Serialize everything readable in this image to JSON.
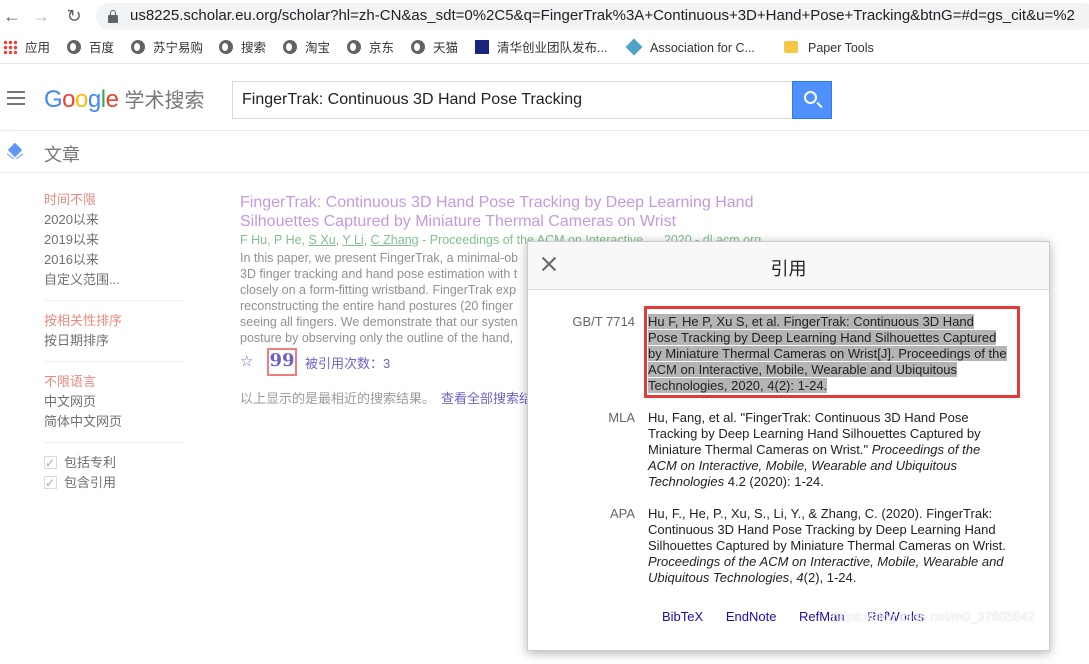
{
  "browser": {
    "url": "us8225.scholar.eu.org/scholar?hl=zh-CN&as_sdt=0%2C5&q=FingerTrak%3A+Continuous+3D+Hand+Pose+Tracking&btnG=#d=gs_cit&u=%2",
    "bookmarks": [
      "应用",
      "百度",
      "苏宁易购",
      "搜索",
      "淘宝",
      "京东",
      "天猫",
      "清华创业团队发布...",
      "Association for C...",
      "Paper Tools"
    ]
  },
  "header": {
    "logo_letters": [
      "G",
      "o",
      "o",
      "g",
      "l",
      "e"
    ],
    "logo_suffix": "学术搜索",
    "search_value": "FingerTrak: Continuous 3D Hand Pose Tracking",
    "section_title": "文章"
  },
  "sidebar": {
    "time_filters": [
      "时间不限",
      "2020以来",
      "2019以来",
      "2016以来",
      "自定义范围..."
    ],
    "sort_options": [
      "按相关性排序",
      "按日期排序"
    ],
    "language_options": [
      "不限语言",
      "中文网页",
      "简体中文网页"
    ],
    "include_options": [
      "包括专利",
      "包含引用"
    ]
  },
  "result": {
    "title_line1": "FingerTrak: Continuous 3D Hand Pose Tracking by Deep Learning Hand",
    "title_line2": "Silhouettes Captured by Miniature Thermal Cameras on Wrist",
    "authors_plain1": "F Hu, P He, ",
    "authors_link1": "S Xu",
    "sep1": ", ",
    "authors_link2": "Y Li",
    "sep2": ", ",
    "authors_link3": "C Zhang",
    "venue": " - Proceedings of the ACM on Interactive ..., 2020 - dl.acm.org",
    "snippet": [
      "In this paper, we present FingerTrak, a minimal-ob",
      "3D finger tracking and hand pose estimation with t",
      "closely on a form-fitting wristband. FingerTrak exp",
      "reconstructing the entire hand postures (20 finger",
      "seeing all fingers. We demonstrate that our systen",
      "posture by observing only the outline of the hand,"
    ],
    "cite_glyph": "99",
    "cited_by": "被引用次数：3",
    "bottom_note": "以上显示的是最相近的搜索结果。",
    "bottom_link": "查看全部搜索结"
  },
  "dialog": {
    "title": "引用",
    "citations": [
      {
        "label": "GB/T 7714",
        "lines": [
          "Hu F, He P, Xu S, et al. FingerTrak: Continuous 3D Hand",
          "Pose Tracking by Deep Learning Hand Silhouettes Captured",
          "by Miniature Thermal Cameras on Wrist[J]. Proceedings of the",
          "ACM on Interactive, Mobile, Wearable and Ubiquitous",
          "Technologies, 2020, 4(2): 1-24."
        ]
      },
      {
        "label": "MLA",
        "line1": "Hu, Fang, et al. \"FingerTrak: Continuous 3D Hand Pose",
        "line2": "Tracking by Deep Learning Hand Silhouettes Captured by",
        "line3_plain": "Miniature Thermal Cameras on Wrist.\" ",
        "line3_italic": "Proceedings of the",
        "line4_italic": "ACM on Interactive, Mobile, Wearable and Ubiquitous",
        "line5_italic": "Technologies",
        "line5_plain": " 4.2 (2020): 1-24."
      },
      {
        "label": "APA",
        "line1": "Hu, F., He, P., Xu, S., Li, Y., & Zhang, C. (2020). FingerTrak:",
        "line2": "Continuous 3D Hand Pose Tracking by Deep Learning Hand",
        "line3": "Silhouettes Captured by Miniature Thermal Cameras on Wrist.",
        "line4_italic": "Proceedings of the ACM on Interactive, Mobile, Wearable and",
        "line5_italic_a": "Ubiquitous Technologies",
        "line5_plain_a": ", ",
        "line5_italic_b": "4",
        "line5_plain_b": "(2), 1-24."
      }
    ],
    "export_links": [
      "BibTeX",
      "EndNote",
      "RefMan",
      "RefWorks"
    ]
  },
  "watermark": "https://blog.csdn.net/m0_37605642"
}
